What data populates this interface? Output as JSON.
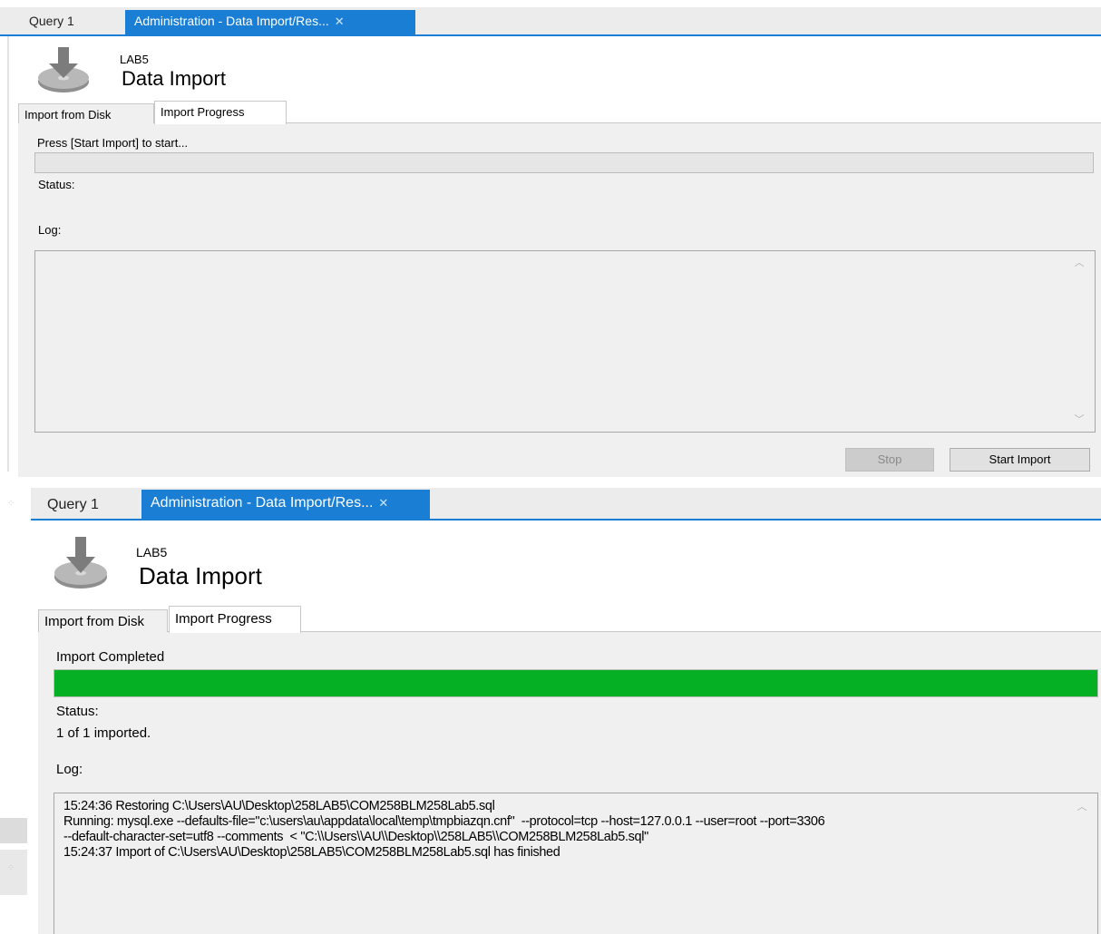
{
  "panels": [
    {
      "doc_tabs": [
        {
          "label": "Query 1",
          "active": false
        },
        {
          "label": "Administration - Data Import/Res...",
          "active": true
        }
      ],
      "header": {
        "server": "LAB5",
        "title": "Data Import"
      },
      "sub_tabs": [
        {
          "label": "Import from Disk",
          "active": false
        },
        {
          "label": "Import Progress",
          "active": true
        }
      ],
      "progress_message": "Press [Start Import] to start...",
      "progress_percent": 0,
      "status_label": "Status:",
      "status_value": "",
      "log_label": "Log:",
      "log_lines": [],
      "buttons": {
        "stop": "Stop",
        "start": "Start Import"
      }
    },
    {
      "doc_tabs": [
        {
          "label": "Query 1",
          "active": false
        },
        {
          "label": "Administration - Data Import/Res...",
          "active": true
        }
      ],
      "header": {
        "server": "LAB5",
        "title": "Data Import"
      },
      "sub_tabs": [
        {
          "label": "Import from Disk",
          "active": false
        },
        {
          "label": "Import Progress",
          "active": true
        }
      ],
      "progress_message": "Import Completed",
      "progress_percent": 100,
      "status_label": "Status:",
      "status_value": "1 of 1 imported.",
      "log_label": "Log:",
      "log_lines": [
        "15:24:36 Restoring C:\\Users\\AU\\Desktop\\258LAB5\\COM258BLM258Lab5.sql",
        "Running: mysql.exe --defaults-file=\"c:\\users\\au\\appdata\\local\\temp\\tmpbiazqn.cnf\"  --protocol=tcp --host=127.0.0.1 --user=root --port=3306",
        "--default-character-set=utf8 --comments  < \"C:\\\\Users\\\\AU\\\\Desktop\\\\258LAB5\\\\COM258BLM258Lab5.sql\"",
        "15:24:37 Import of C:\\Users\\AU\\Desktop\\258LAB5\\COM258BLM258Lab5.sql has finished"
      ]
    }
  ],
  "colors": {
    "accent": "#1a7fd4",
    "progress_complete": "#06b025"
  },
  "icons": {
    "close": "close-icon",
    "import": "download-disk-icon",
    "scroll_up": "chevron-up-icon",
    "scroll_down": "chevron-down-icon"
  }
}
